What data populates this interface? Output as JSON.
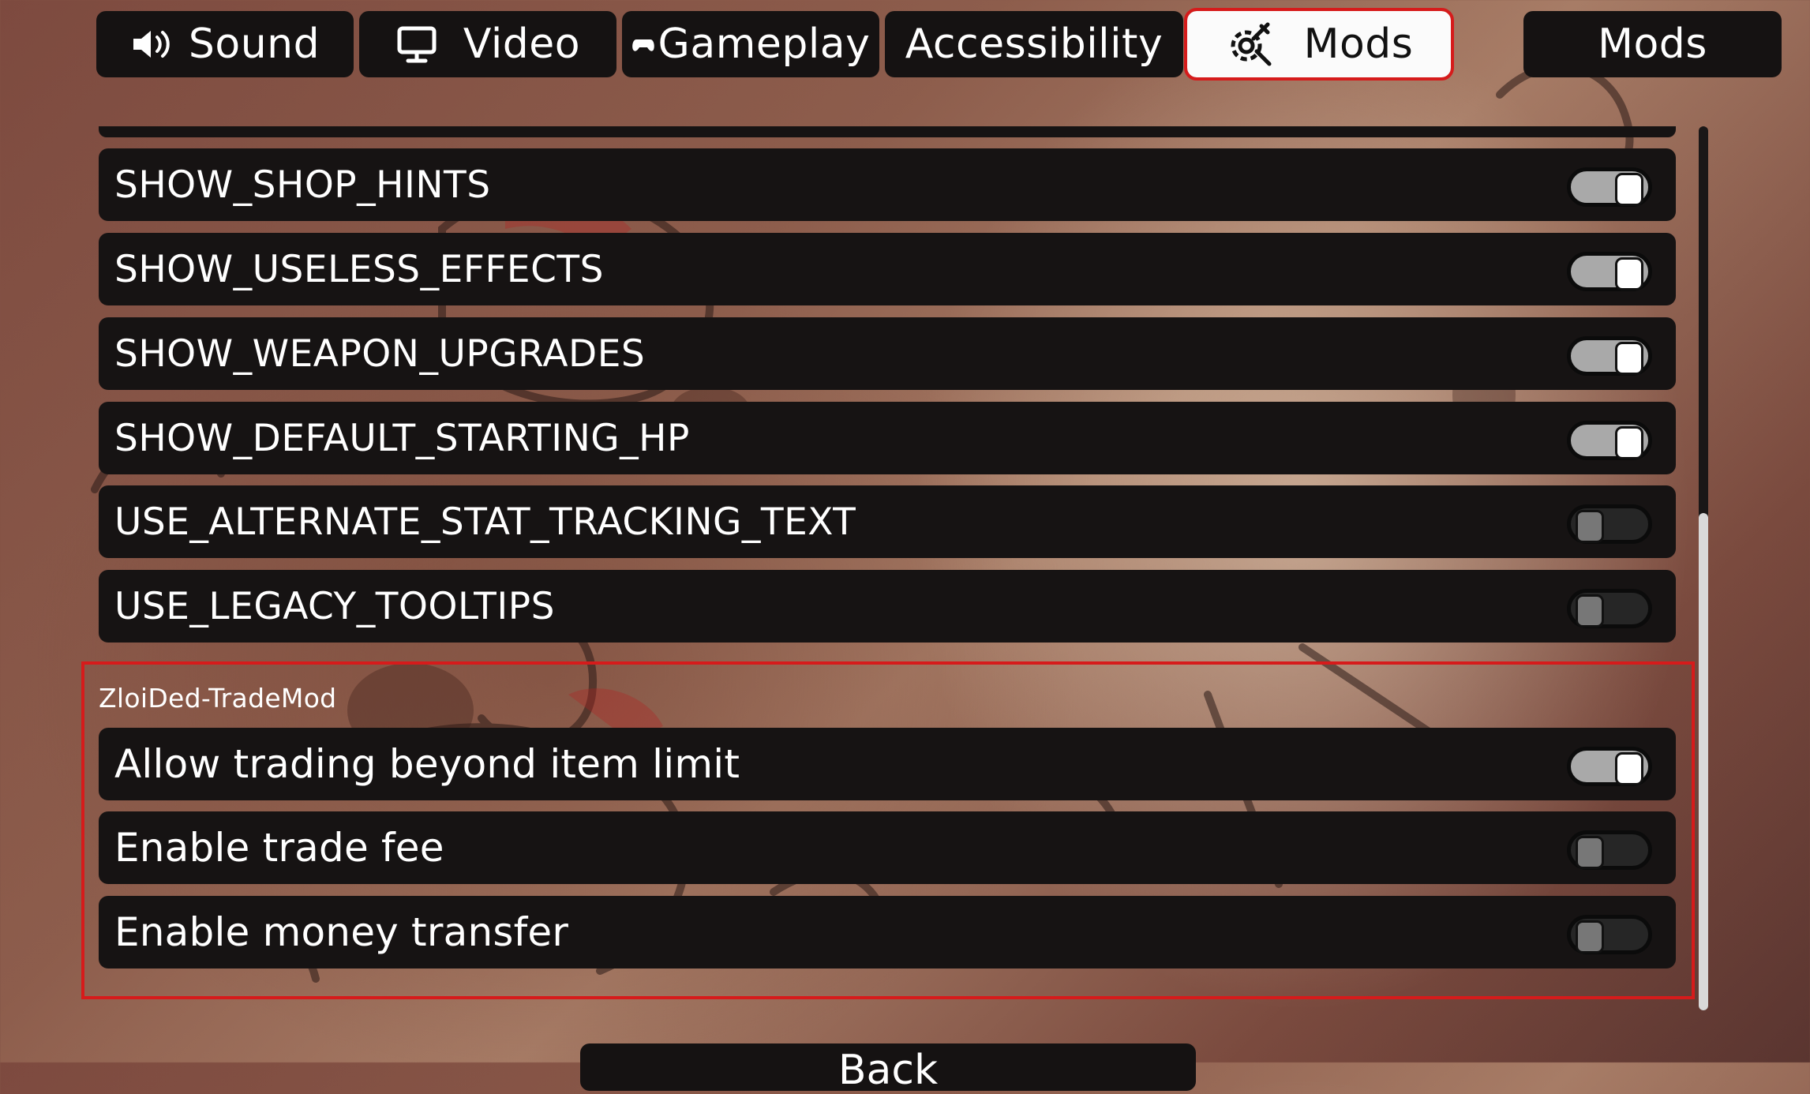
{
  "tabs": [
    {
      "label": "Sound",
      "icon": "speaker-icon"
    },
    {
      "label": "Video",
      "icon": "monitor-icon"
    },
    {
      "label": "Gameplay",
      "icon": "gamepad-icon"
    },
    {
      "label": "Accessibility",
      "icon": ""
    },
    {
      "label": "Mods",
      "icon": "gear-wrench-icon",
      "active": true
    }
  ],
  "right_tab": {
    "label": "Mods"
  },
  "settings": [
    {
      "label": "SHOW_SHOP_HINTS",
      "on": true
    },
    {
      "label": "SHOW_USELESS_EFFECTS",
      "on": true
    },
    {
      "label": "SHOW_WEAPON_UPGRADES",
      "on": true
    },
    {
      "label": "SHOW_DEFAULT_STARTING_HP",
      "on": true
    },
    {
      "label": "USE_ALTERNATE_STAT_TRACKING_TEXT",
      "on": false
    },
    {
      "label": "USE_LEGACY_TOOLTIPS",
      "on": false
    }
  ],
  "mod_section": {
    "title": "ZloiDed-TradeMod",
    "options": [
      {
        "label": "Allow trading beyond item limit",
        "on": true
      },
      {
        "label": "Enable trade fee",
        "on": false
      },
      {
        "label": "Enable money transfer",
        "on": false
      }
    ]
  },
  "footer": {
    "back_label": "Back"
  },
  "colors": {
    "highlight": "#d61b1b",
    "panel": "#161313",
    "active_tab": "#fbfbfb"
  }
}
